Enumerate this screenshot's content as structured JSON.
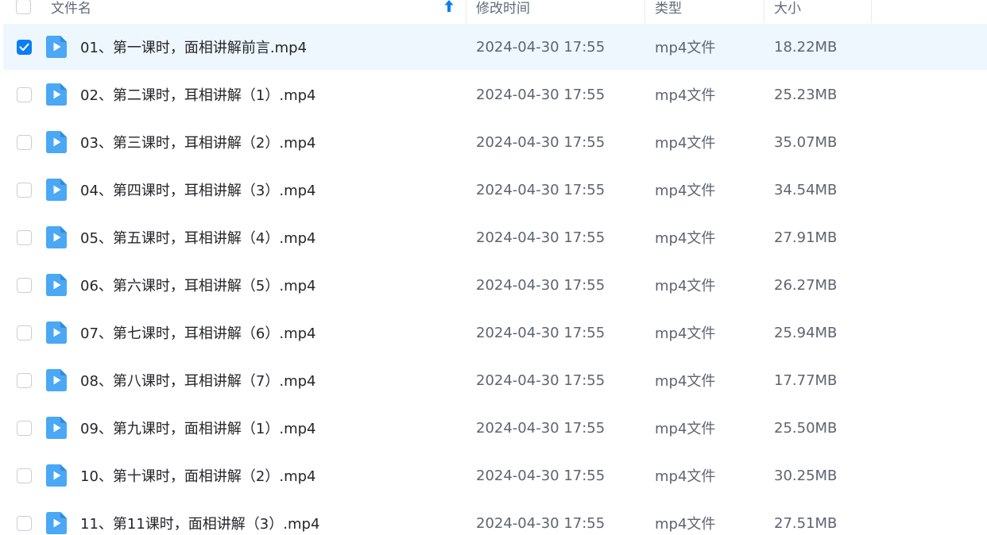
{
  "header": {
    "name_label": "文件名",
    "time_label": "修改时间",
    "type_label": "类型",
    "size_label": "大小"
  },
  "colors": {
    "accent": "#0a7ef3",
    "selected_row_bg": "#eef7fe",
    "file_icon": "#4aa8f5"
  },
  "sort_icon": "sort-ascending-arrow-icon",
  "file_icon_name": "video-file-icon",
  "rows": [
    {
      "name": "01、第一课时，面相讲解前言.mp4",
      "time": "2024-04-30 17:55",
      "type": "mp4文件",
      "size": "18.22MB",
      "checked": true
    },
    {
      "name": "02、第二课时，耳相讲解（1）.mp4",
      "time": "2024-04-30 17:55",
      "type": "mp4文件",
      "size": "25.23MB",
      "checked": false
    },
    {
      "name": "03、第三课时，耳相讲解（2）.mp4",
      "time": "2024-04-30 17:55",
      "type": "mp4文件",
      "size": "35.07MB",
      "checked": false
    },
    {
      "name": "04、第四课时，耳相讲解（3）.mp4",
      "time": "2024-04-30 17:55",
      "type": "mp4文件",
      "size": "34.54MB",
      "checked": false
    },
    {
      "name": "05、第五课时，耳相讲解（4）.mp4",
      "time": "2024-04-30 17:55",
      "type": "mp4文件",
      "size": "27.91MB",
      "checked": false
    },
    {
      "name": "06、第六课时，耳相讲解（5）.mp4",
      "time": "2024-04-30 17:55",
      "type": "mp4文件",
      "size": "26.27MB",
      "checked": false
    },
    {
      "name": "07、第七课时，耳相讲解（6）.mp4",
      "time": "2024-04-30 17:55",
      "type": "mp4文件",
      "size": "25.94MB",
      "checked": false
    },
    {
      "name": "08、第八课时，耳相讲解（7）.mp4",
      "time": "2024-04-30 17:55",
      "type": "mp4文件",
      "size": "17.77MB",
      "checked": false
    },
    {
      "name": "09、第九课时，面相讲解（1）.mp4",
      "time": "2024-04-30 17:55",
      "type": "mp4文件",
      "size": "25.50MB",
      "checked": false
    },
    {
      "name": "10、第十课时，面相讲解（2）.mp4",
      "time": "2024-04-30 17:55",
      "type": "mp4文件",
      "size": "30.25MB",
      "checked": false
    },
    {
      "name": "11、第11课时，面相讲解（3）.mp4",
      "time": "2024-04-30 17:55",
      "type": "mp4文件",
      "size": "27.51MB",
      "checked": false
    }
  ]
}
